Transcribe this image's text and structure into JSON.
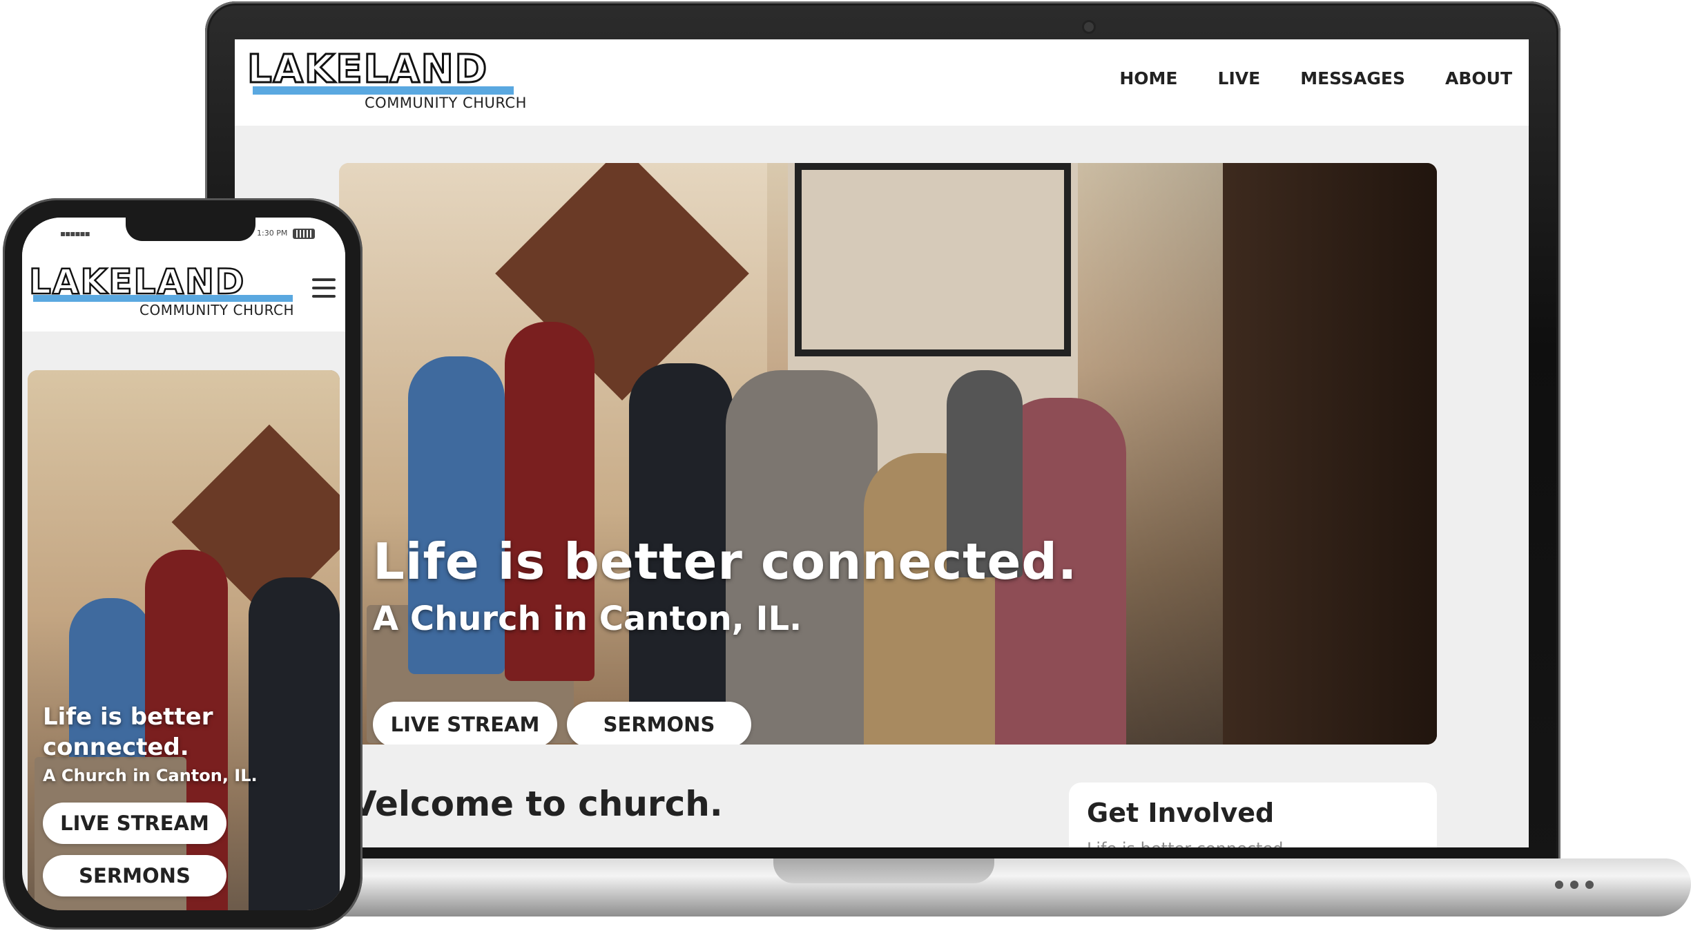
{
  "brand": {
    "logo_word": "LAKELAND",
    "logo_sub": "COMMUNITY CHURCH",
    "accent_color": "#5aa8e0"
  },
  "desktop": {
    "nav": [
      "HOME",
      "LIVE",
      "MESSAGES",
      "ABOUT"
    ],
    "hero": {
      "title": "Life is better connected.",
      "subtitle": "A Church in Canton, IL.",
      "buttons": [
        "LIVE STREAM",
        "SERMONS"
      ]
    },
    "welcome": "Velcome to church.",
    "card": {
      "title": "Get Involved",
      "text": "Life is better connected"
    }
  },
  "mobile": {
    "status": {
      "time": "1:30 PM",
      "signal": "▪▪▪▪▪▪"
    },
    "hero": {
      "title": "Life is better connected.",
      "subtitle": "A Church in Canton, IL.",
      "buttons": [
        "LIVE STREAM",
        "SERMONS"
      ]
    },
    "menu_icon": "hamburger-icon"
  }
}
